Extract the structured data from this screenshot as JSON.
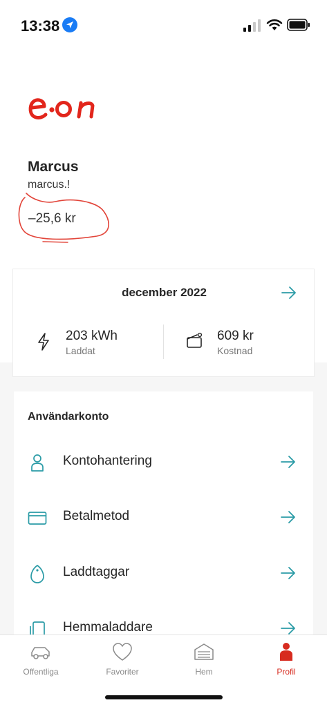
{
  "status_bar": {
    "time": "13:38"
  },
  "brand": {
    "logo_text": "e·on",
    "logo_color": "#e2261c",
    "accent_color": "#2a9ba6"
  },
  "user": {
    "name": "Marcus",
    "email": "marcus.!",
    "balance": "–25,6 kr"
  },
  "summary": {
    "month": "december 2022",
    "charged_value": "203 kWh",
    "charged_label": "Laddat",
    "cost_value": "609 kr",
    "cost_label": "Kostnad"
  },
  "account": {
    "title": "Användarkonto",
    "items": [
      {
        "label": "Kontohantering",
        "icon": "person-icon"
      },
      {
        "label": "Betalmetod",
        "icon": "credit-card-icon"
      },
      {
        "label": "Laddtaggar",
        "icon": "tag-icon"
      },
      {
        "label": "Hemmaladdare",
        "icon": "home-charger-icon"
      }
    ]
  },
  "tabs": [
    {
      "label": "Offentliga",
      "icon": "car-icon",
      "active": false
    },
    {
      "label": "Favoriter",
      "icon": "heart-icon",
      "active": false
    },
    {
      "label": "Hem",
      "icon": "garage-icon",
      "active": false
    },
    {
      "label": "Profil",
      "icon": "profile-icon",
      "active": true
    }
  ]
}
